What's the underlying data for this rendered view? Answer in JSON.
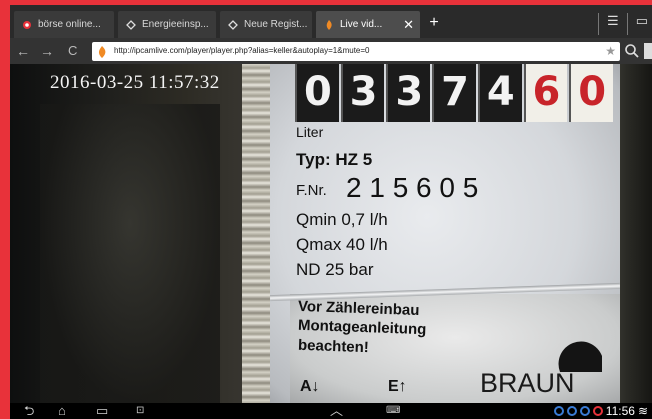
{
  "browser": {
    "tabs": [
      {
        "title": "börse online...",
        "icon": "opera-icon"
      },
      {
        "title": "Energieeinsp...",
        "icon": "page-icon"
      },
      {
        "title": "Neue Regist...",
        "icon": "page-icon"
      },
      {
        "title": "Live vid...",
        "icon": "flame-icon",
        "active": true
      }
    ],
    "url": "http://ipcamlive.com/player/player.php?alias=keller&autoplay=1&mute=0",
    "colors": {
      "accent": "#e8323a",
      "tabstrip": "#2a2a2a",
      "toolbar": "#333333"
    }
  },
  "video": {
    "timestamp": "2016-03-25  11:57:32",
    "meter": {
      "digits": [
        "0",
        "3",
        "3",
        "7",
        "4",
        "6",
        "0"
      ],
      "red_digits_from": 5,
      "unit": "Liter",
      "type": "Typ: HZ 5",
      "fnr_label": "F.Nr.",
      "fnr_value": "2 1 5 6 0 5",
      "qmin": "Qmin 0,7 l/h",
      "qmax": "Qmax 40 l/h",
      "nd": "ND 25 bar",
      "note_line1": "Vor Zählereinbau",
      "note_line2": "Montageanleitung",
      "note_line3": "beachten!",
      "arrow_a": "A↓",
      "arrow_e": "E↑",
      "brand": "BRAUN"
    }
  },
  "system": {
    "clock": "11:56"
  }
}
